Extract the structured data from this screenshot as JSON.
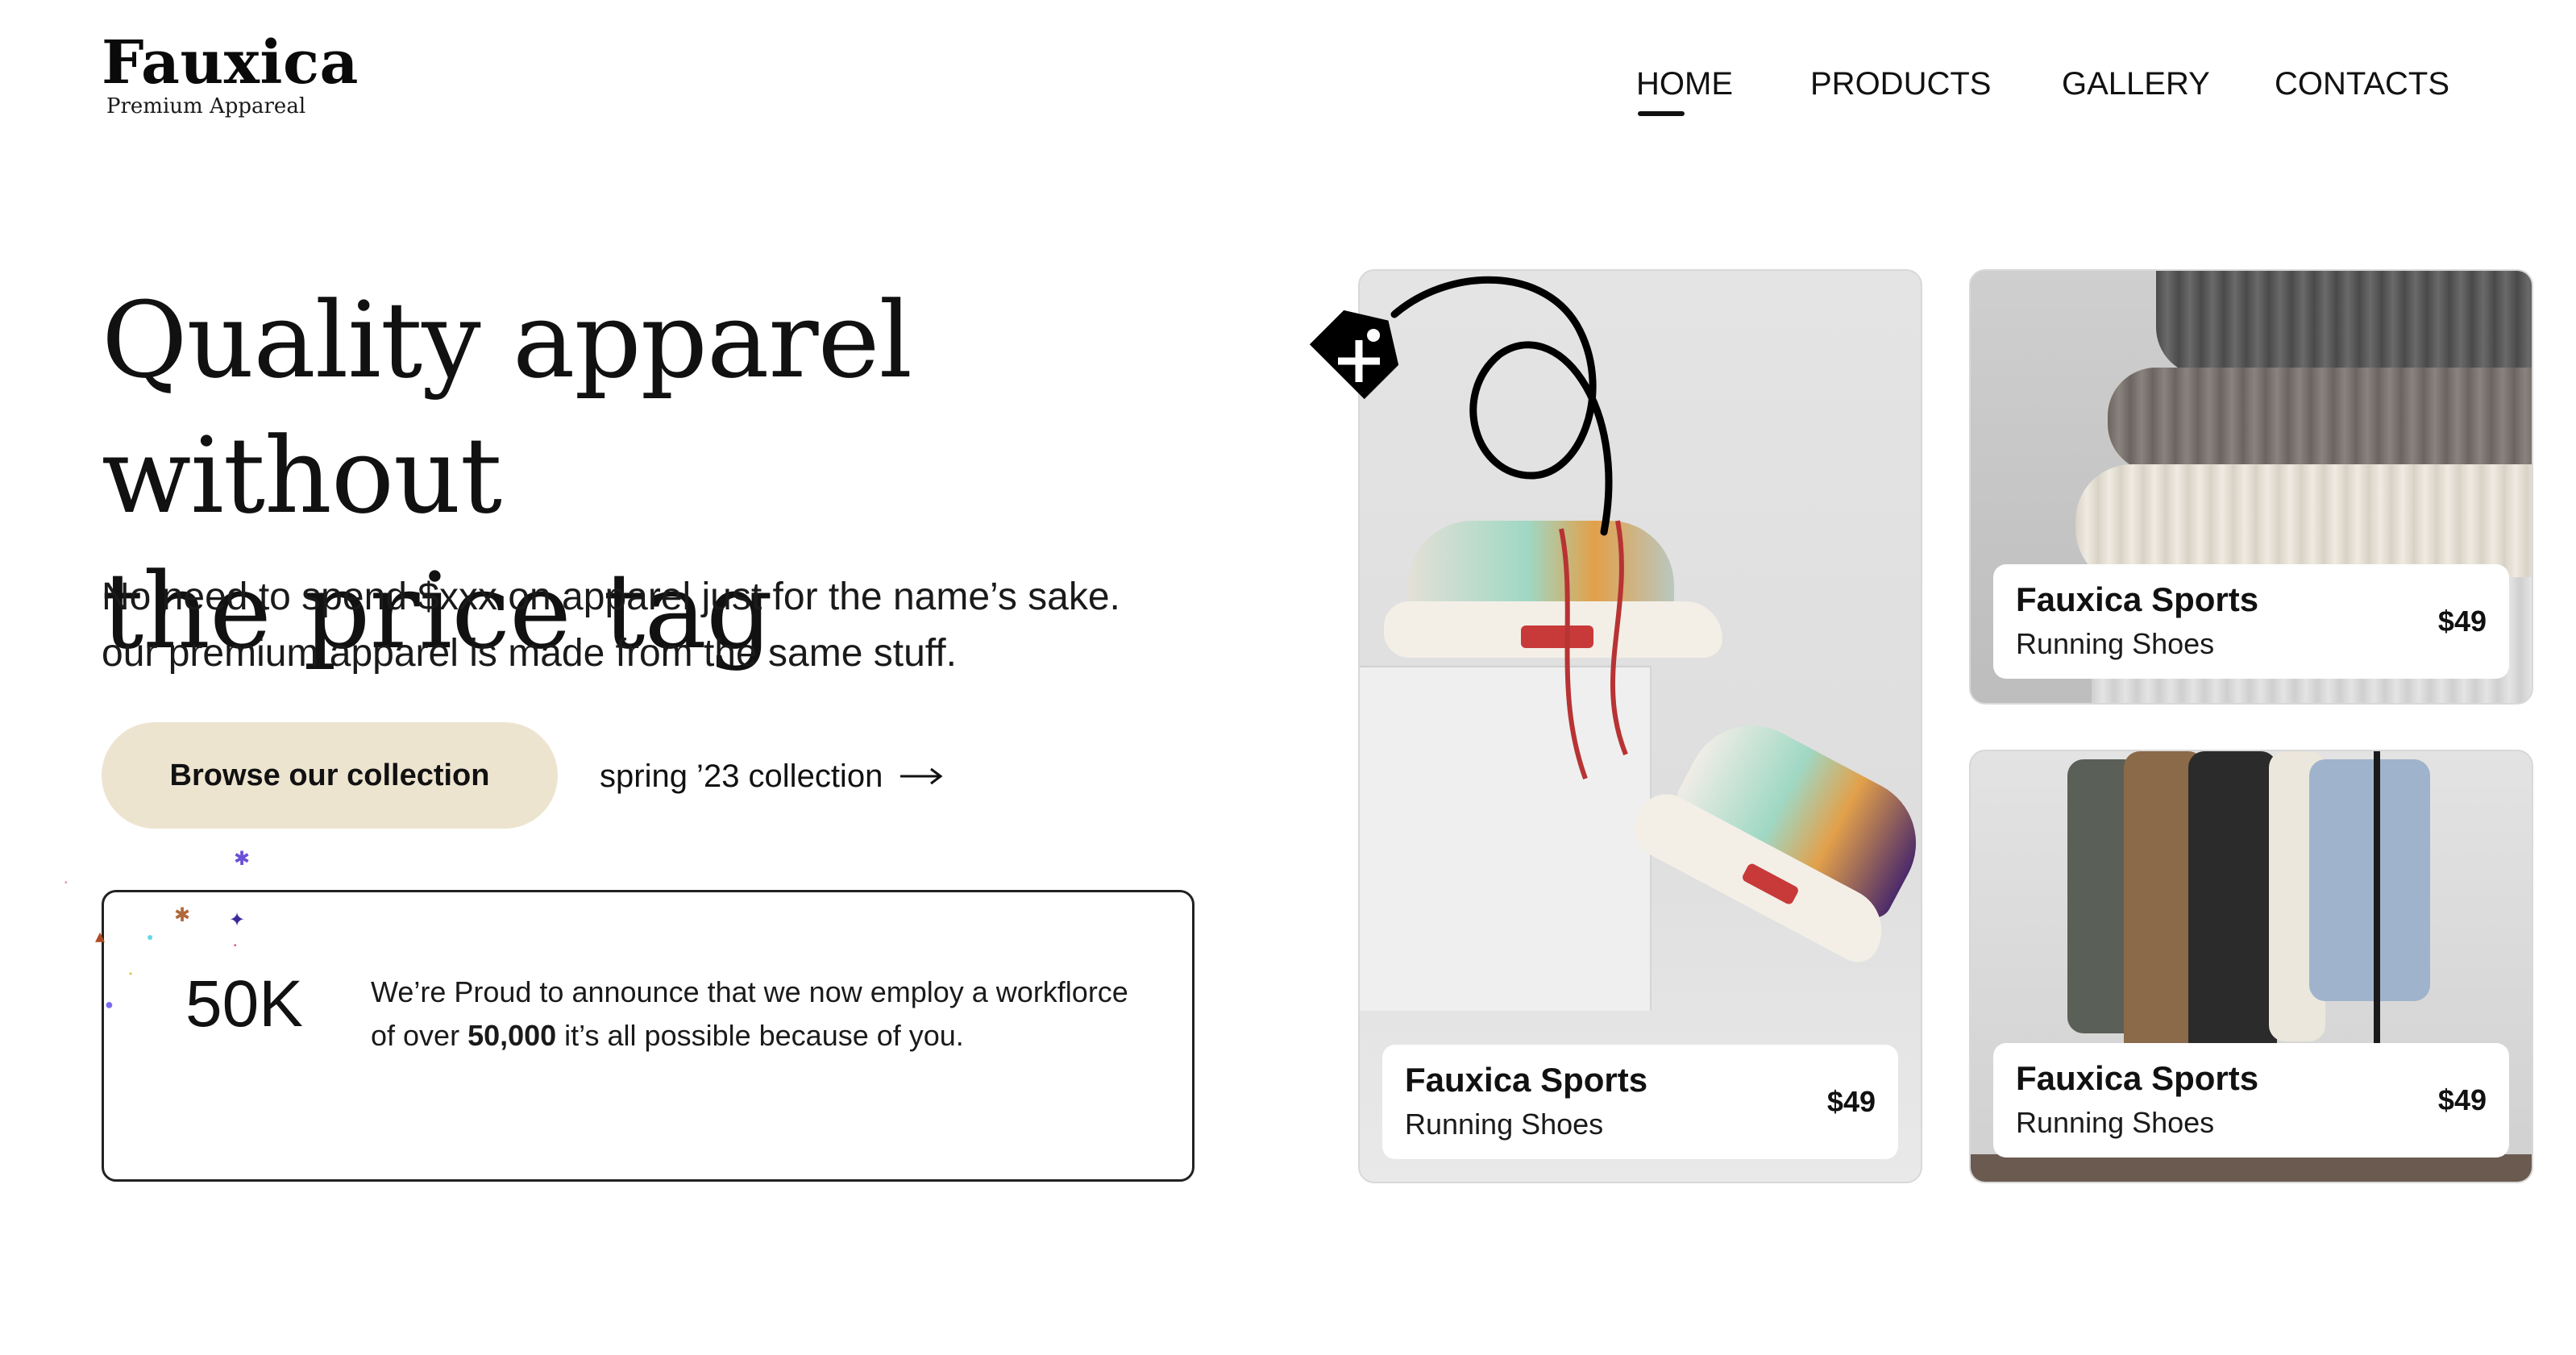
{
  "brand": {
    "name": "Fauxica",
    "tagline": "Premium Appareal"
  },
  "nav": {
    "items": [
      {
        "label": "HOME",
        "active": true
      },
      {
        "label": "PRODUCTS",
        "active": false
      },
      {
        "label": "GALLERY",
        "active": false
      },
      {
        "label": "CONTACTS",
        "active": false
      }
    ]
  },
  "hero": {
    "headline_line1": "Quality apparel without",
    "headline_line2": "the price tag",
    "subtext_line1": "No need to spend $xxx on apparel just for the name’s sake.",
    "subtext_line2": "our premium apparel is made from the same stuff.",
    "primary_cta": "Browse our collection",
    "secondary_link": "spring ’23 collection",
    "secondary_link_icon": "arrow-right-icon"
  },
  "announcement": {
    "count": "50K",
    "text_before": "We’re Proud to announce that we now employ a workflorce of over ",
    "text_bold": "50,000",
    "text_after": " it’s all possible because of you."
  },
  "products": [
    {
      "brand": "Fauxica Sports",
      "type": "Running Shoes",
      "price": "$49",
      "image": "sneakers-photo"
    },
    {
      "brand": "Fauxica Sports",
      "type": "Running Shoes",
      "price": "$49",
      "image": "knit-sweaters-photo"
    },
    {
      "brand": "Fauxica Sports",
      "type": "Running Shoes",
      "price": "$49",
      "image": "jackets-on-rack-photo"
    }
  ],
  "colors": {
    "cta_bg": "#ede4d0",
    "text": "#111111",
    "accent_tag": "#0a0a0a"
  },
  "decorative_icon": "price-tag-icon"
}
